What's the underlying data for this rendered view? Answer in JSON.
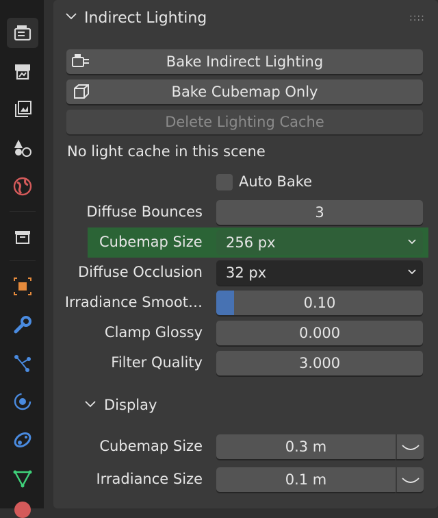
{
  "sidebar": {
    "tabs": [
      {
        "icon": "render-camera-icon",
        "color": "#d8d8d8"
      },
      {
        "icon": "output-printer-icon",
        "color": "#d8d8d8"
      },
      {
        "icon": "view-layer-icon",
        "color": "#d8d8d8"
      },
      {
        "icon": "scene-icon",
        "color": "#d8d8d8"
      },
      {
        "icon": "world-icon",
        "color": "#d45a5a"
      },
      {
        "icon": "collection-icon",
        "color": "#d8d8d8"
      },
      {
        "icon": "object-icon",
        "color": "#e58a3c"
      },
      {
        "icon": "modifier-wrench-icon",
        "color": "#4a8be0"
      },
      {
        "icon": "particles-icon",
        "color": "#4a8be0"
      },
      {
        "icon": "physics-icon",
        "color": "#4a8be0"
      },
      {
        "icon": "constraints-icon",
        "color": "#4a8be0"
      },
      {
        "icon": "mesh-data-icon",
        "color": "#3fd17a"
      }
    ]
  },
  "panel": {
    "title": "Indirect Lighting",
    "bake_indirect_label": "Bake Indirect Lighting",
    "bake_cubemap_label": "Bake Cubemap Only",
    "delete_cache_label": "Delete Lighting Cache",
    "status_text": "No light cache in this scene",
    "auto_bake_label": "Auto Bake",
    "diffuse_bounces_label": "Diffuse Bounces",
    "diffuse_bounces_value": "3",
    "cubemap_size_label": "Cubemap Size",
    "cubemap_size_value": "256 px",
    "diffuse_occlusion_label": "Diffuse Occlusion",
    "diffuse_occlusion_value": "32 px",
    "irradiance_smooth_label": "Irradiance Smoot…",
    "irradiance_smooth_value": "0.10",
    "irradiance_smooth_fraction": 0.1,
    "clamp_glossy_label": "Clamp Glossy",
    "clamp_glossy_value": "0.000",
    "filter_quality_label": "Filter Quality",
    "filter_quality_value": "3.000"
  },
  "display": {
    "title": "Display",
    "cubemap_size_label": "Cubemap Size",
    "cubemap_size_value": "0.3 m",
    "irradiance_size_label": "Irradiance Size",
    "irradiance_size_value": "0.1 m"
  },
  "colors": {
    "highlight": "#2b6436",
    "slider_fill": "#4772b3"
  }
}
